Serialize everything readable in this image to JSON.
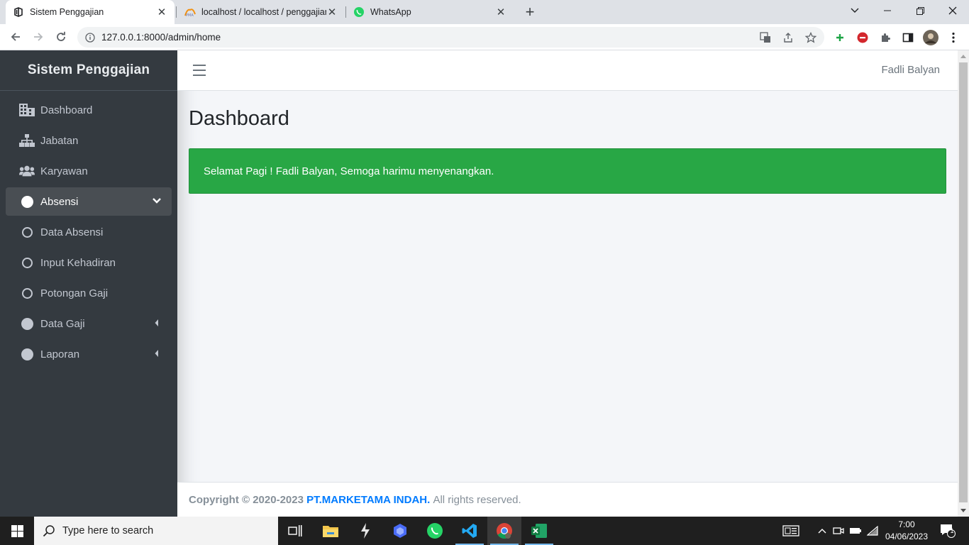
{
  "browser": {
    "tabs": [
      {
        "title": "Sistem Penggajian",
        "active": true
      },
      {
        "title": "localhost / localhost / penggajian",
        "active": false
      },
      {
        "title": "WhatsApp",
        "active": false
      }
    ],
    "url": "127.0.0.1:8000/admin/home"
  },
  "sidebar": {
    "brand": "Sistem Penggajian",
    "items": [
      {
        "label": "Dashboard",
        "icon": "building-icon"
      },
      {
        "label": "Jabatan",
        "icon": "sitemap-icon"
      },
      {
        "label": "Karyawan",
        "icon": "users-icon"
      },
      {
        "label": "Absensi",
        "icon": "circle-icon",
        "active": true,
        "expanded": true
      },
      {
        "label": "Data Absensi",
        "icon": "circle-outline-icon"
      },
      {
        "label": "Input Kehadiran",
        "icon": "circle-outline-icon"
      },
      {
        "label": "Potongan Gaji",
        "icon": "circle-outline-icon"
      },
      {
        "label": "Data Gaji",
        "icon": "circle-icon"
      },
      {
        "label": "Laporan",
        "icon": "circle-icon"
      }
    ]
  },
  "header": {
    "user_name": "Fadli Balyan"
  },
  "main": {
    "title": "Dashboard",
    "alert": "Selamat Pagi ! Fadli Balyan, Semoga harimu menyenangkan.",
    "alert_color": "#28a745"
  },
  "footer": {
    "prefix": "Copyright © 2020-2023",
    "company": "PT.MARKETAMA INDAH.",
    "suffix": "All rights reserved."
  },
  "taskbar": {
    "search_placeholder": "Type here to search",
    "time": "7:00",
    "date": "04/06/2023",
    "notification_count": "1"
  },
  "colors": {
    "sidebar_bg": "#343a40",
    "accent": "#007bff",
    "success": "#28a745"
  }
}
